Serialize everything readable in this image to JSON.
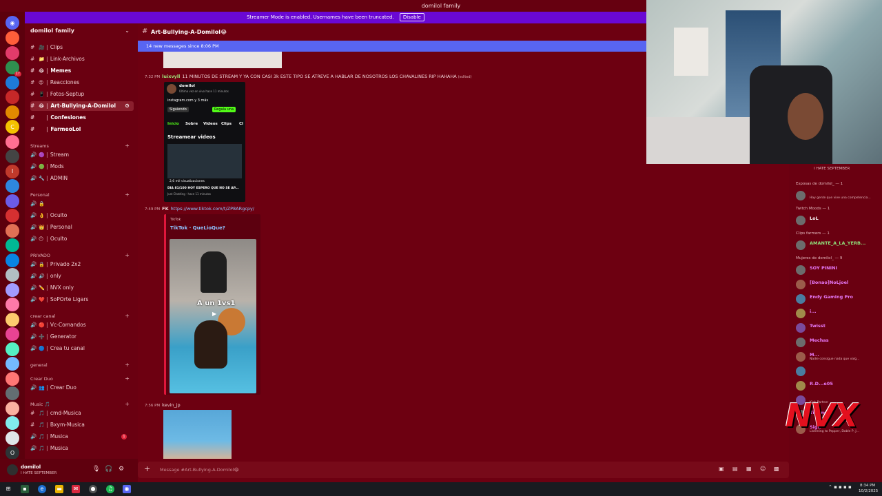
{
  "window": {
    "title": "domilol family"
  },
  "banner": {
    "text": "Streamer Mode is enabled. Usernames have been truncated.",
    "disable": "Disable"
  },
  "rail": {
    "home_icon": "discord-logo-icon",
    "servers": [
      {
        "label": "",
        "badge": ""
      },
      {
        "label": "",
        "badge": ""
      },
      {
        "label": "",
        "badge": "17"
      },
      {
        "label": "",
        "badge": ""
      },
      {
        "label": "",
        "badge": ""
      },
      {
        "label": "",
        "badge": ""
      },
      {
        "label": "C",
        "badge": ""
      },
      {
        "label": "",
        "badge": ""
      },
      {
        "label": "",
        "badge": ""
      },
      {
        "label": "I",
        "badge": ""
      },
      {
        "label": "",
        "badge": ""
      },
      {
        "label": "",
        "badge": ""
      },
      {
        "label": "",
        "badge": ""
      },
      {
        "label": "",
        "badge": ""
      },
      {
        "label": "",
        "badge": ""
      },
      {
        "label": "",
        "badge": ""
      },
      {
        "label": "",
        "badge": ""
      },
      {
        "label": "",
        "badge": ""
      },
      {
        "label": "",
        "badge": ""
      },
      {
        "label": "",
        "badge": ""
      },
      {
        "label": "",
        "badge": ""
      },
      {
        "label": "",
        "badge": ""
      },
      {
        "label": "",
        "badge": ""
      },
      {
        "label": "",
        "badge": ""
      },
      {
        "label": "",
        "badge": ""
      },
      {
        "label": "",
        "badge": ""
      },
      {
        "label": "",
        "badge": ""
      },
      {
        "label": "",
        "badge": ""
      },
      {
        "label": "O",
        "badge": ""
      },
      {
        "label": "NEW",
        "badge": ""
      }
    ]
  },
  "sidebar": {
    "guild_name": "domilol family",
    "channels_top": [
      {
        "label": "Clips",
        "emoji": "🎥",
        "bold": false
      },
      {
        "label": "Link-Archivos",
        "emoji": "📁",
        "bold": false
      },
      {
        "label": "Memes",
        "emoji": "😂",
        "bold": true
      },
      {
        "label": "Reacciones",
        "emoji": "😮",
        "bold": false
      },
      {
        "label": "Fotos-Septup",
        "emoji": "📱",
        "bold": false
      },
      {
        "label": "Art-Bullying-A-Domilol",
        "emoji": "😂",
        "bold": true,
        "active": true
      },
      {
        "label": "Confesiones",
        "emoji": "",
        "bold": true
      },
      {
        "label": "FarmeoLol",
        "emoji": "",
        "bold": true
      }
    ],
    "cat_streams": "Streams",
    "streams": [
      {
        "label": "Stream",
        "emoji": "🟣"
      },
      {
        "label": "Mods",
        "emoji": "🟢"
      },
      {
        "label": "ADMIN",
        "emoji": "🔧"
      }
    ],
    "cat_personal": "Personal",
    "personal": [
      {
        "label": "",
        "emoji": "🔒"
      },
      {
        "label": "Oculto",
        "emoji": "👌"
      },
      {
        "label": "Personal",
        "emoji": "👑"
      },
      {
        "label": "Oculto",
        "emoji": "😶"
      }
    ],
    "cat_privado": "PRIVADO",
    "privado": [
      {
        "label": "Privado 2x2",
        "emoji": "🔒"
      },
      {
        "label": "only",
        "emoji": "🔊"
      },
      {
        "label": "NVX only",
        "emoji": "✏️"
      },
      {
        "label": "SoPOrte Ligars",
        "emoji": "❤️"
      }
    ],
    "cat_crear": "crear canal",
    "crear": [
      {
        "label": "Vc-Comandos",
        "emoji": "🔴"
      },
      {
        "label": "Generator",
        "emoji": "➕"
      },
      {
        "label": "Crea tu canal",
        "emoji": "🔵"
      }
    ],
    "cat_general": "general",
    "cat_duo": "Crear Duo",
    "duo": [
      {
        "label": "Crear Duo",
        "emoji": "👥"
      }
    ],
    "cat_music": "Music 🎵",
    "music": [
      {
        "label": "cmd-Musica",
        "emoji": "🎵"
      },
      {
        "label": "Bxym-Musica",
        "emoji": "🎵"
      },
      {
        "label": "Musica",
        "emoji": "🎵",
        "unread": "1"
      },
      {
        "label": "Musica",
        "emoji": "🎵"
      }
    ]
  },
  "user": {
    "name": "domilol",
    "status": "I HATE SEPTEMBER"
  },
  "header": {
    "channel": "Art-Bullying-A-Domilol😂"
  },
  "new_messages": "14 new messages since 8:06 PM",
  "messages": {
    "m1_time": "7:32 PM",
    "m1_author": "luixvyll",
    "m1_text": "11 MINUTOS DE STREAM Y YA CON CASI 3k ESTE TIPO SE ATREVE A HABLAR DE NOSOTROS LOS CHAVALINES RIP HAHAHA",
    "m1_edited": "(edited)",
    "ig_name": "domilol",
    "ig_sub": "Última vez en vivo hace 11 minutos",
    "ig_link": "instagram.com y 3 más",
    "ig_follow": "Siguiendo",
    "ig_gift": "Regala una",
    "ig_tabs": [
      "Inicio",
      "Sobre",
      "Videos",
      "Clips",
      "Cl"
    ],
    "ig_section": "Streamear videos",
    "ig_views": "2,6 mil visualizaciones",
    "ig_caption": "DIA 81/100 HOY ESPERO QUE NO SE AP...",
    "ig_cat": "Just Chatting · hace 11 minutos",
    "m2_time": "7:49 PM",
    "m2_author": "FK",
    "m2_link": "https://www.tiktok.com/t/ZP8ARgcpy/",
    "embed_provider": "TikTok",
    "embed_title": "TikTok · QueLioQue?",
    "embed_overlay": "A un 1vs1",
    "m3_time": "7:56 PM",
    "m3_author": "kevin_jp"
  },
  "composer": {
    "placeholder": "Message #Art-Bullying-A-Domilol😂"
  },
  "members": {
    "top_status": "I HATE SEPTEMBER",
    "groups": [
      {
        "title": "Esposas de domilol_ — 1",
        "members": [
          {
            "name": "",
            "sub": "Hay gente que vive una competencia...",
            "color": "#b06cff"
          }
        ]
      },
      {
        "title": "Twitch Moods — 1",
        "members": [
          {
            "name": "LoL",
            "sub": "",
            "color": "#ffffff"
          }
        ]
      },
      {
        "title": "Clips farmers — 1",
        "members": [
          {
            "name": "AMANTE_A_LA_YERB...",
            "sub": "",
            "color": "#8fe07a"
          }
        ]
      },
      {
        "title": "Mujeres de domilol_ — 9",
        "members": [
          {
            "name": "SOY PININI",
            "sub": "",
            "color": "#e879f9"
          },
          {
            "name": "[Bonao]NoLjoel",
            "sub": "",
            "color": "#e879f9"
          },
          {
            "name": "Endy Gaming Pro",
            "sub": "",
            "color": "#e879f9"
          },
          {
            "name": "i...",
            "sub": "",
            "color": "#e879f9"
          },
          {
            "name": "Twisst",
            "sub": "",
            "color": "#e879f9"
          },
          {
            "name": "Mechas",
            "sub": "",
            "color": "#e879f9"
          },
          {
            "name": "M...",
            "sub": "Nadie consigue nada que valg...",
            "color": "#e879f9"
          },
          {
            "name": "",
            "sub": "",
            "color": "#e879f9"
          },
          {
            "name": "R.D...e05",
            "sub": "",
            "color": "#e879f9"
          },
          {
            "name": "",
            "sub": "Kick Partner",
            "color": "#e879f9"
          },
          {
            "name": "Tirame",
            "sub": "",
            "color": "#e879f9"
          },
          {
            "name": "Sigh",
            "sub": "Listening to Pepper, Doble P, J...",
            "color": "#e879f9"
          }
        ]
      }
    ]
  },
  "nvx_logo": "NVX",
  "taskbar": {
    "time": "8:34 PM",
    "date": "10/2/2025"
  }
}
